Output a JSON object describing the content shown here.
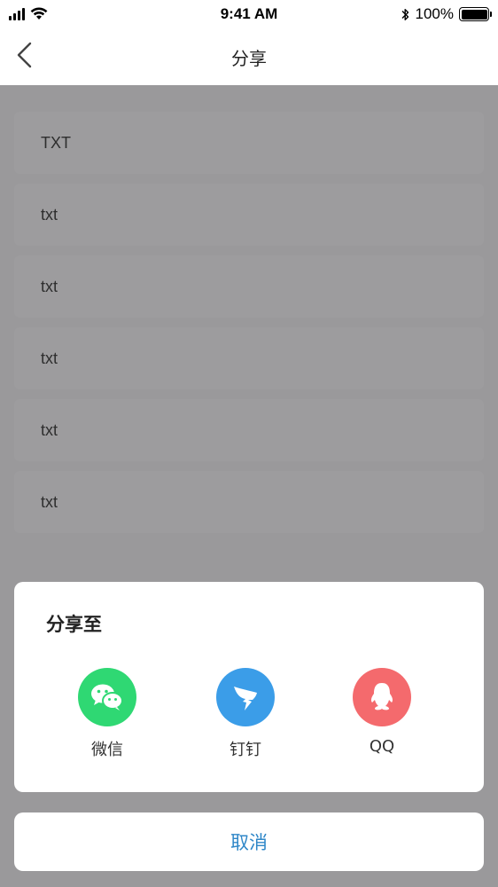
{
  "status_bar": {
    "time": "9:41 AM",
    "battery": "100%",
    "battery_level": 1.0,
    "icons": [
      "signal-icon",
      "wifi-icon",
      "bluetooth-icon",
      "battery-icon"
    ]
  },
  "nav": {
    "back_icon": "chevron-left-icon",
    "title": "分享"
  },
  "list": {
    "items": [
      {
        "label": "TXT"
      },
      {
        "label": "txt"
      },
      {
        "label": "txt"
      },
      {
        "label": "txt"
      },
      {
        "label": "txt"
      },
      {
        "label": "txt"
      }
    ]
  },
  "share_sheet": {
    "title": "分享至",
    "options": [
      {
        "label": "微信",
        "icon": "wechat-icon",
        "color": "#2fd873"
      },
      {
        "label": "钉钉",
        "icon": "dingtalk-icon",
        "color": "#3b9de8"
      },
      {
        "label": "QQ",
        "icon": "qq-icon",
        "color": "#f46a6d"
      }
    ]
  },
  "cancel": {
    "label": "取消",
    "color": "#2f87c8"
  },
  "colors": {
    "overlay": "#9a999b",
    "sheet_background": "#ffffff"
  }
}
